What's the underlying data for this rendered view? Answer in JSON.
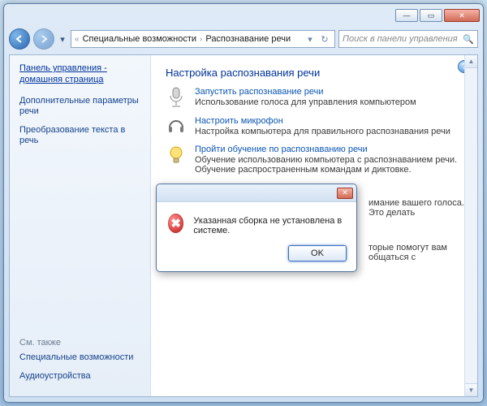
{
  "titlebar": {
    "minimize": "—",
    "maximize": "▭",
    "close": "✕"
  },
  "address": {
    "chev_left": "«",
    "crumb1": "Специальные возможности",
    "sep": "›",
    "crumb2": "Распознавание речи",
    "dropdown": "▾",
    "refresh": "↻"
  },
  "search": {
    "placeholder": "Поиск в панели управления",
    "icon": "🔍"
  },
  "sidebar": {
    "panel_home": "Панель управления - домашняя страница",
    "links": [
      "Дополнительные параметры речи",
      "Преобразование текста в речь"
    ],
    "see_also_header": "См. также",
    "see_also": [
      "Специальные возможности",
      "Аудиоустройства"
    ]
  },
  "content": {
    "heading": "Настройка распознавания речи",
    "help_icon": "?",
    "items": [
      {
        "link": "Запустить распознавание речи",
        "desc": "Использование голоса для управления компьютером"
      },
      {
        "link": "Настроить микрофон",
        "desc": "Настройка компьютера для правильного распознавания речи"
      },
      {
        "link": "Пройти обучение по распознаванию речи",
        "desc": "Обучение использованию компьютера с распознаванием речи.  Обучение распространенным командам и диктовке."
      }
    ],
    "partial1": "имание вашего голоса. Это делать",
    "partial2": "торые помогут вам общаться с"
  },
  "dialog": {
    "close": "✕",
    "message": "Указанная сборка не установлена в системе.",
    "ok": "OK"
  }
}
